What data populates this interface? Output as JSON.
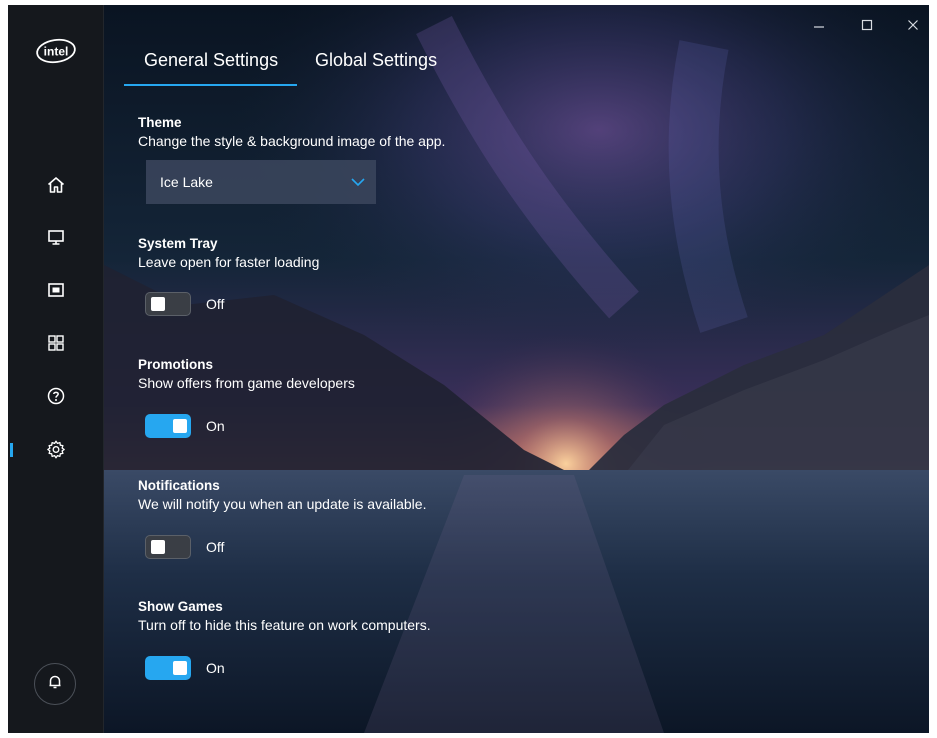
{
  "window": {
    "controls": [
      "minimize",
      "maximize",
      "close"
    ]
  },
  "sidebar": {
    "logo_text": "intel",
    "items": [
      {
        "icon": "home-icon",
        "active": false
      },
      {
        "icon": "monitor-icon",
        "active": false
      },
      {
        "icon": "media-icon",
        "active": false
      },
      {
        "icon": "apps-grid-icon",
        "active": false
      },
      {
        "icon": "help-icon",
        "active": false
      },
      {
        "icon": "gear-icon",
        "active": true
      }
    ],
    "bottom_icon": "bell-icon"
  },
  "tabs": [
    {
      "label": "General Settings",
      "active": true
    },
    {
      "label": "Global Settings",
      "active": false
    }
  ],
  "settings": {
    "theme": {
      "title": "Theme",
      "description": "Change the style & background image of the app.",
      "selected": "Ice Lake"
    },
    "system_tray": {
      "title": "System Tray",
      "description": "Leave open for faster loading",
      "state": "Off"
    },
    "promotions": {
      "title": "Promotions",
      "description": "Show offers from game developers",
      "state": "On"
    },
    "notifications": {
      "title": "Notifications",
      "description": "We will notify you when an update is available.",
      "state": "Off"
    },
    "show_games": {
      "title": "Show Games",
      "description": "Turn off to hide this feature on work computers.",
      "state": "On"
    }
  },
  "colors": {
    "accent": "#26a7f0",
    "sidebar_bg": "#15181d",
    "text": "#ffffff"
  }
}
